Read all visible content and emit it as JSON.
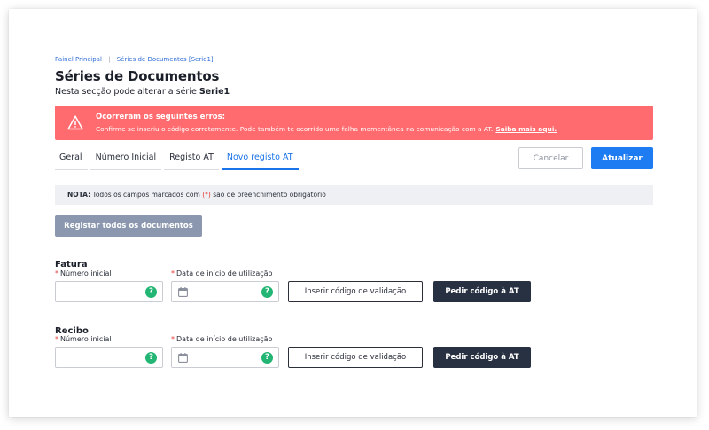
{
  "breadcrumb": {
    "home": "Painel Principal",
    "separator": "|",
    "current": "Séries de Documentos [Serie1]"
  },
  "page": {
    "title": "Séries de Documentos",
    "subtitle_prefix": "Nesta secção pode alterar a série",
    "series_name": "Serie1"
  },
  "alert": {
    "icon": "warning-triangle-icon",
    "title": "Ocorreram os seguintes erros:",
    "message": "Confirme se inseriu o código corretamente. Pode também te ocorrido uma falha momentânea na comunicação com a AT.",
    "link": "Saiba mais aqui."
  },
  "tabs": [
    {
      "label": "Geral",
      "active": false
    },
    {
      "label": "Número Inicial",
      "active": false
    },
    {
      "label": "Registo AT",
      "active": false
    },
    {
      "label": "Novo registo AT",
      "active": true
    }
  ],
  "actions": {
    "cancel_label": "Cancelar",
    "update_label": "Atualizar"
  },
  "note": {
    "bold": "NOTA:",
    "text_before": "Todos os campos marcados com",
    "marker": "(*)",
    "text_after": "são de preenchimento obrigatório"
  },
  "register_all_label": "Registar todos os documentos",
  "sections": [
    {
      "title": "Fatura",
      "number_label": "Número inicial",
      "number_value": "",
      "date_label": "Data de início de utilização",
      "date_value": "",
      "required_marker": "*",
      "help_glyph": "?",
      "insert_code_label": "Inserir código de validação",
      "ask_code_label": "Pedir código à AT"
    },
    {
      "title": "Recibo",
      "number_label": "Número inicial",
      "number_value": "",
      "date_label": "Data de início de utilização",
      "date_value": "",
      "required_marker": "*",
      "help_glyph": "?",
      "insert_code_label": "Inserir código de validação",
      "ask_code_label": "Pedir código à AT"
    }
  ],
  "colors": {
    "accent": "#1d7cf2",
    "error": "#ff6b6e",
    "help": "#22b573",
    "dark_button": "#273142",
    "disabled_button": "#8a97ae"
  }
}
